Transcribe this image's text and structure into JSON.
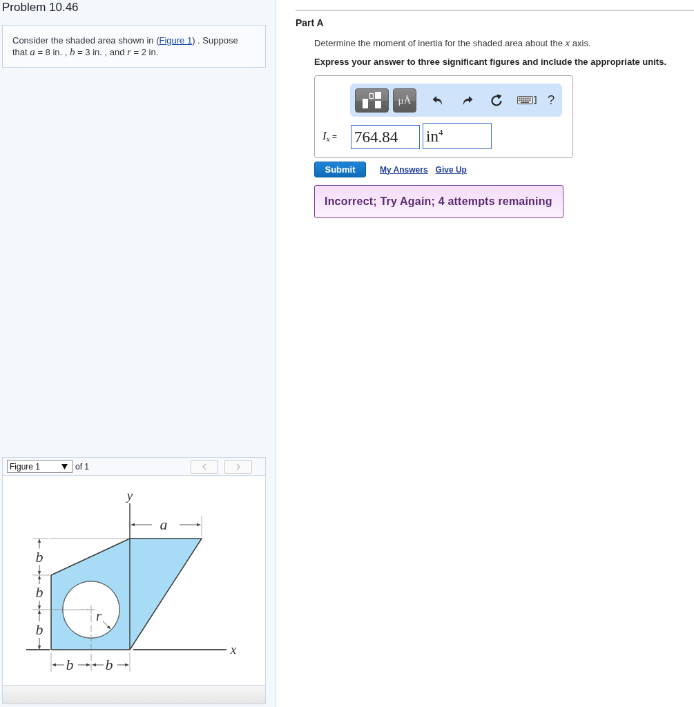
{
  "problem": {
    "title": "Problem 10.46",
    "statement": {
      "before": "Consider the shaded area shown in (",
      "link": "Figure 1",
      "after": ") . Suppose that *a* = 8 in. , *b* = 3 in. , and *r* = 2 in."
    }
  },
  "figure_viewer": {
    "selector": "Figure 1",
    "of": "of 1",
    "prev": {
      "disabled": true
    },
    "next": {
      "disabled": true
    },
    "diagram": {
      "y_axis_label": "y",
      "x_axis_label": "x",
      "width_label": "a",
      "height_labels": [
        "b",
        "b",
        "b"
      ],
      "base_labels": [
        "b",
        "b"
      ],
      "radius_label": "r"
    }
  },
  "part": {
    "title": "Part A",
    "question": "Determine the moment of inertia for the shaded area about the *x* axis.",
    "instruction": "Express your answer to three significant figures and include the appropriate units.",
    "toolbar": [
      {
        "kind": "templates"
      },
      {
        "kind": "units",
        "label": "μÅ"
      },
      {
        "kind": "undo"
      },
      {
        "kind": "redo"
      },
      {
        "kind": "reset"
      },
      {
        "kind": "keyboard"
      },
      {
        "kind": "help",
        "label": "?"
      }
    ],
    "answer": {
      "label": "*I*$_{x}$ =",
      "value": "764.84",
      "units": "in$^{4}$"
    },
    "submit": "Submit",
    "links": [
      "My Answers",
      "Give Up"
    ],
    "feedback": "Incorrect; Try Again; 4 attempts remaining"
  }
}
